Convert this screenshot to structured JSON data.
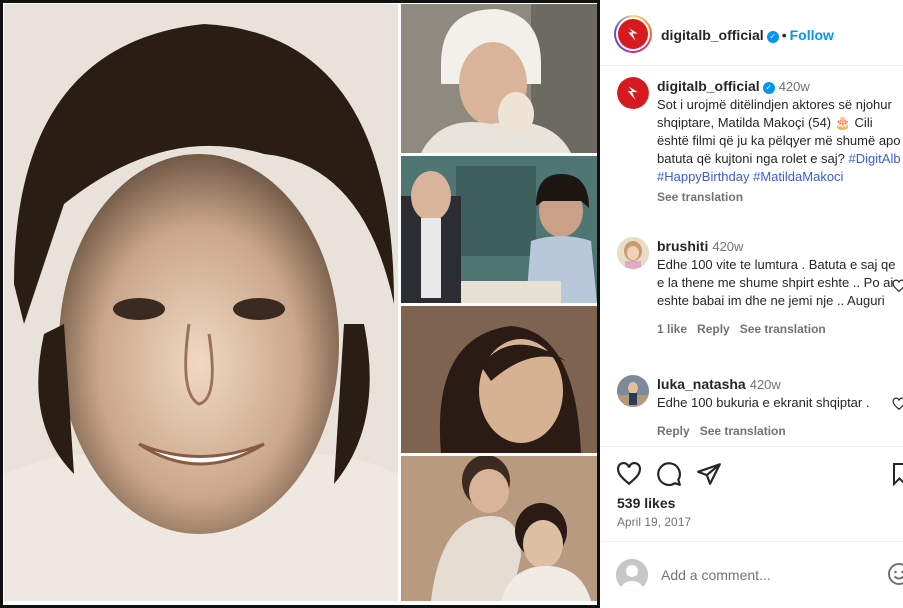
{
  "header": {
    "username": "digitalb_official",
    "separator": "•",
    "follow_label": "Follow",
    "more": "⋮"
  },
  "caption": {
    "username": "digitalb_official",
    "time": "420w",
    "text": "Sot i urojmë ditëlindjen aktores së njohur shqiptare, Matilda Makoçi (54) 🎂 Cili është filmi që ju ka pëlqyer më shumë apo batuta që kujtoni nga rolet e saj?",
    "hashtags": [
      "#DigitAlb",
      "#HappyBirthday",
      "#MatildaMakoci"
    ],
    "see_translation": "See translation"
  },
  "comments": [
    {
      "username": "brushiti",
      "time": "420w",
      "text": "Edhe 100 vite te lumtura . Batuta e saj qe e la thene me shume shpirt eshte .. Po ai eshte babai im dhe ne jemi nje .. Auguri",
      "likes": "1 like",
      "reply": "Reply",
      "see_translation": "See translation"
    },
    {
      "username": "luka_natasha",
      "time": "420w",
      "text": "Edhe 100 bukuria e ekranit shqiptar .",
      "reply": "Reply",
      "see_translation": "See translation"
    }
  ],
  "actions": {
    "likes": "539 likes",
    "date": "April 19, 2017"
  },
  "add_comment": {
    "placeholder": "Add a comment..."
  },
  "colors": {
    "brand_red": "#d71920",
    "link_blue": "#0095f6",
    "hashtag": "#3b5bdb"
  }
}
